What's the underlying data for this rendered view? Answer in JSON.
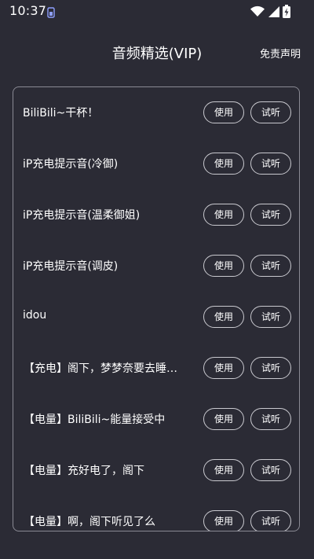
{
  "status_bar": {
    "time": "10:37"
  },
  "header": {
    "title": "音频精选(VIP)",
    "disclaimer": "免责声明"
  },
  "list": {
    "use_label": "使用",
    "try_label": "试听",
    "items": [
      {
        "label": "BiliBili~干杯！"
      },
      {
        "label": "iP充电提示音(冷御)"
      },
      {
        "label": "iP充电提示音(温柔御姐)"
      },
      {
        "label": "iP充电提示音(调皮)"
      },
      {
        "label": "idou"
      },
      {
        "label": "【充电】阁下，梦梦奈要去睡…"
      },
      {
        "label": "【电量】BiliBili~能量接受中"
      },
      {
        "label": "【电量】充好电了，阁下"
      },
      {
        "label": "【电量】啊，阁下听见了么"
      }
    ]
  }
}
